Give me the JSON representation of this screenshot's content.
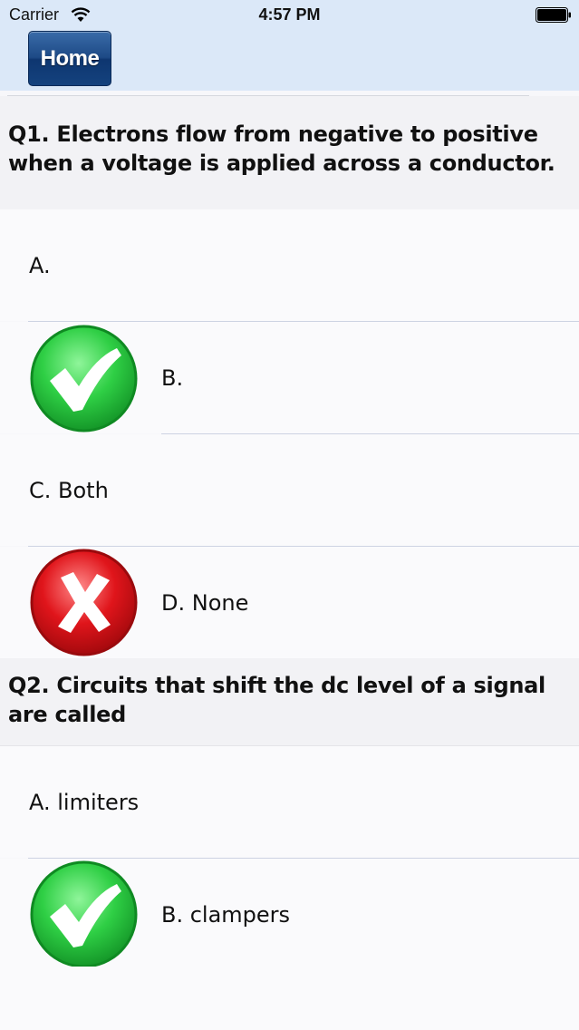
{
  "status_bar": {
    "carrier": "Carrier",
    "time": "4:57 PM",
    "wifi_icon": "wifi-icon",
    "battery_icon": "battery-full-icon"
  },
  "navbar": {
    "home_label": "Home"
  },
  "questions": [
    {
      "text": "Q1. Electrons flow from negative to positive when a voltage is applied across a conductor.",
      "options": [
        {
          "label": "A.",
          "mark": null
        },
        {
          "label": "B.",
          "mark": "check"
        },
        {
          "label": "C. Both",
          "mark": null
        },
        {
          "label": "D. None",
          "mark": "cross"
        }
      ]
    },
    {
      "text": "Q2. Circuits that shift the dc level of a signal are called",
      "options": [
        {
          "label": "A. limiters",
          "mark": null
        },
        {
          "label": "B. clampers",
          "mark": "check"
        }
      ]
    }
  ],
  "colors": {
    "header_background": "#dbe8f8",
    "check_green": "#2fcf45",
    "cross_red": "#e0151b",
    "home_button_blue": "#1d4a86"
  }
}
